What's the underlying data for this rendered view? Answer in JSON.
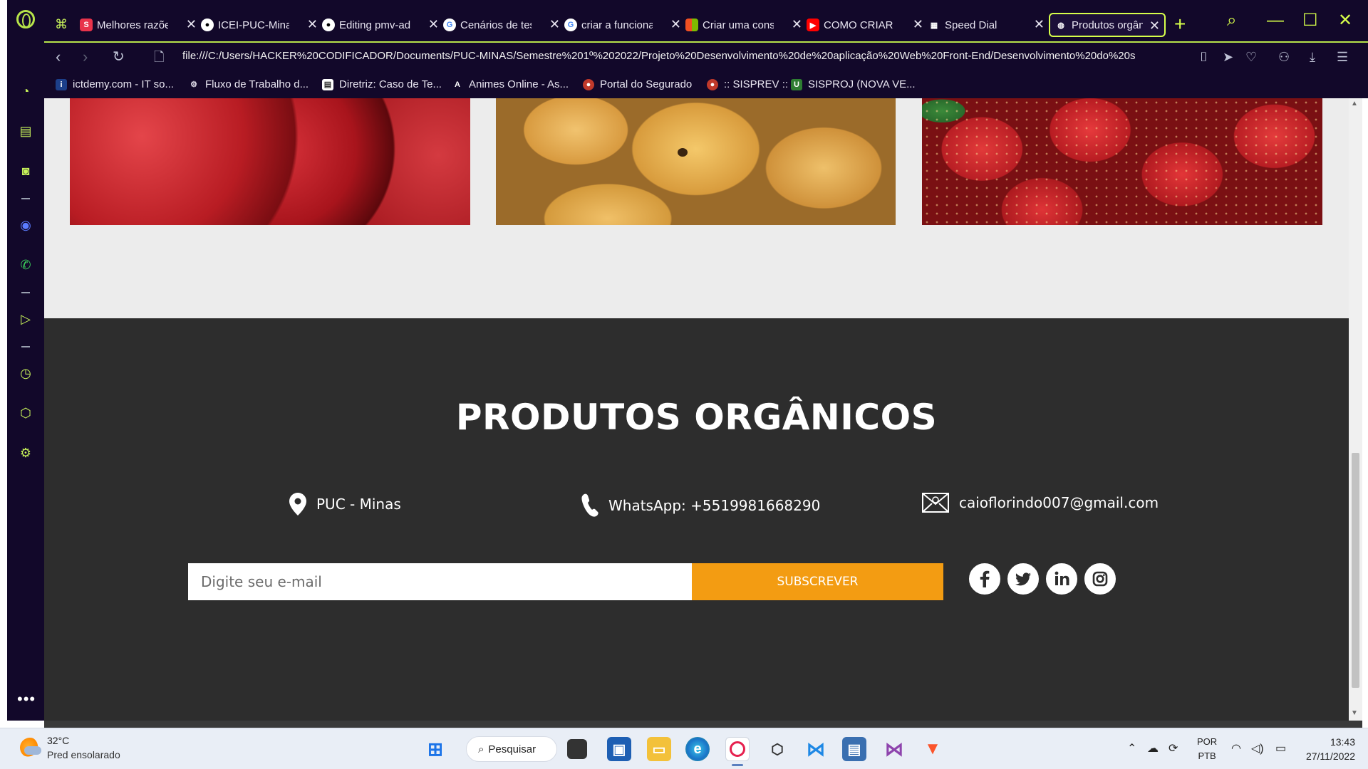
{
  "browser": {
    "tabs": [
      {
        "label": "Melhores razõe",
        "favicon": "s"
      },
      {
        "label": "ICEI-PUC-Minas",
        "favicon": "github-icon"
      },
      {
        "label": "Editing pmv-ad",
        "favicon": "github-icon"
      },
      {
        "label": "Cenários de tes",
        "favicon": "G"
      },
      {
        "label": "criar a funciona",
        "favicon": "G"
      },
      {
        "label": "Criar uma cons",
        "favicon": "microsoft-icon"
      },
      {
        "label": "COMO CRIAR U",
        "favicon": "youtube-icon"
      },
      {
        "label": "Speed Dial",
        "favicon": "grid-icon"
      },
      {
        "label": "Produtos orgân",
        "favicon": "globe-icon",
        "active": true
      }
    ],
    "url": "file:///C:/Users/HACKER%20CODIFICADOR/Documents/PUC-MINAS/Semestre%201º%202022/Projeto%20Desenvolvimento%20de%20aplicação%20Web%20Front-End/Desenvolvimento%20do%20s",
    "bookmarks": [
      {
        "label": "ictdemy.com - IT so..."
      },
      {
        "label": "Fluxo de Trabalho d..."
      },
      {
        "label": "Diretriz: Caso de Te..."
      },
      {
        "label": "Animes Online - As..."
      },
      {
        "label": "Portal do Segurado"
      },
      {
        "label": ":: SISPREV ::"
      },
      {
        "label": "SISPROJ (NOVA VE..."
      }
    ],
    "accent_color": "#d7ff4a"
  },
  "page": {
    "products": [
      "apple",
      "mango",
      "strawberry"
    ],
    "footer": {
      "title": "PRODUTOS ORGÂNICOS",
      "location": "PUC - Minas",
      "phone": "WhatsApp: +5519981668290",
      "email": "caioflorindo007@gmail.com",
      "email_placeholder": "Digite seu e-mail",
      "subscribe_label": "SUBSCREVER",
      "background_color": "#2d2d2d",
      "button_color": "#f39c12",
      "social": [
        "facebook-icon",
        "twitter-icon",
        "linkedin-icon",
        "instagram-icon"
      ]
    }
  },
  "taskbar": {
    "temperature": "32°C",
    "weather": "Pred ensolarado",
    "search_label": "Pesquisar",
    "language_top": "POR",
    "language_bottom": "PTB",
    "time": "13:43",
    "date": "27/11/2022"
  }
}
